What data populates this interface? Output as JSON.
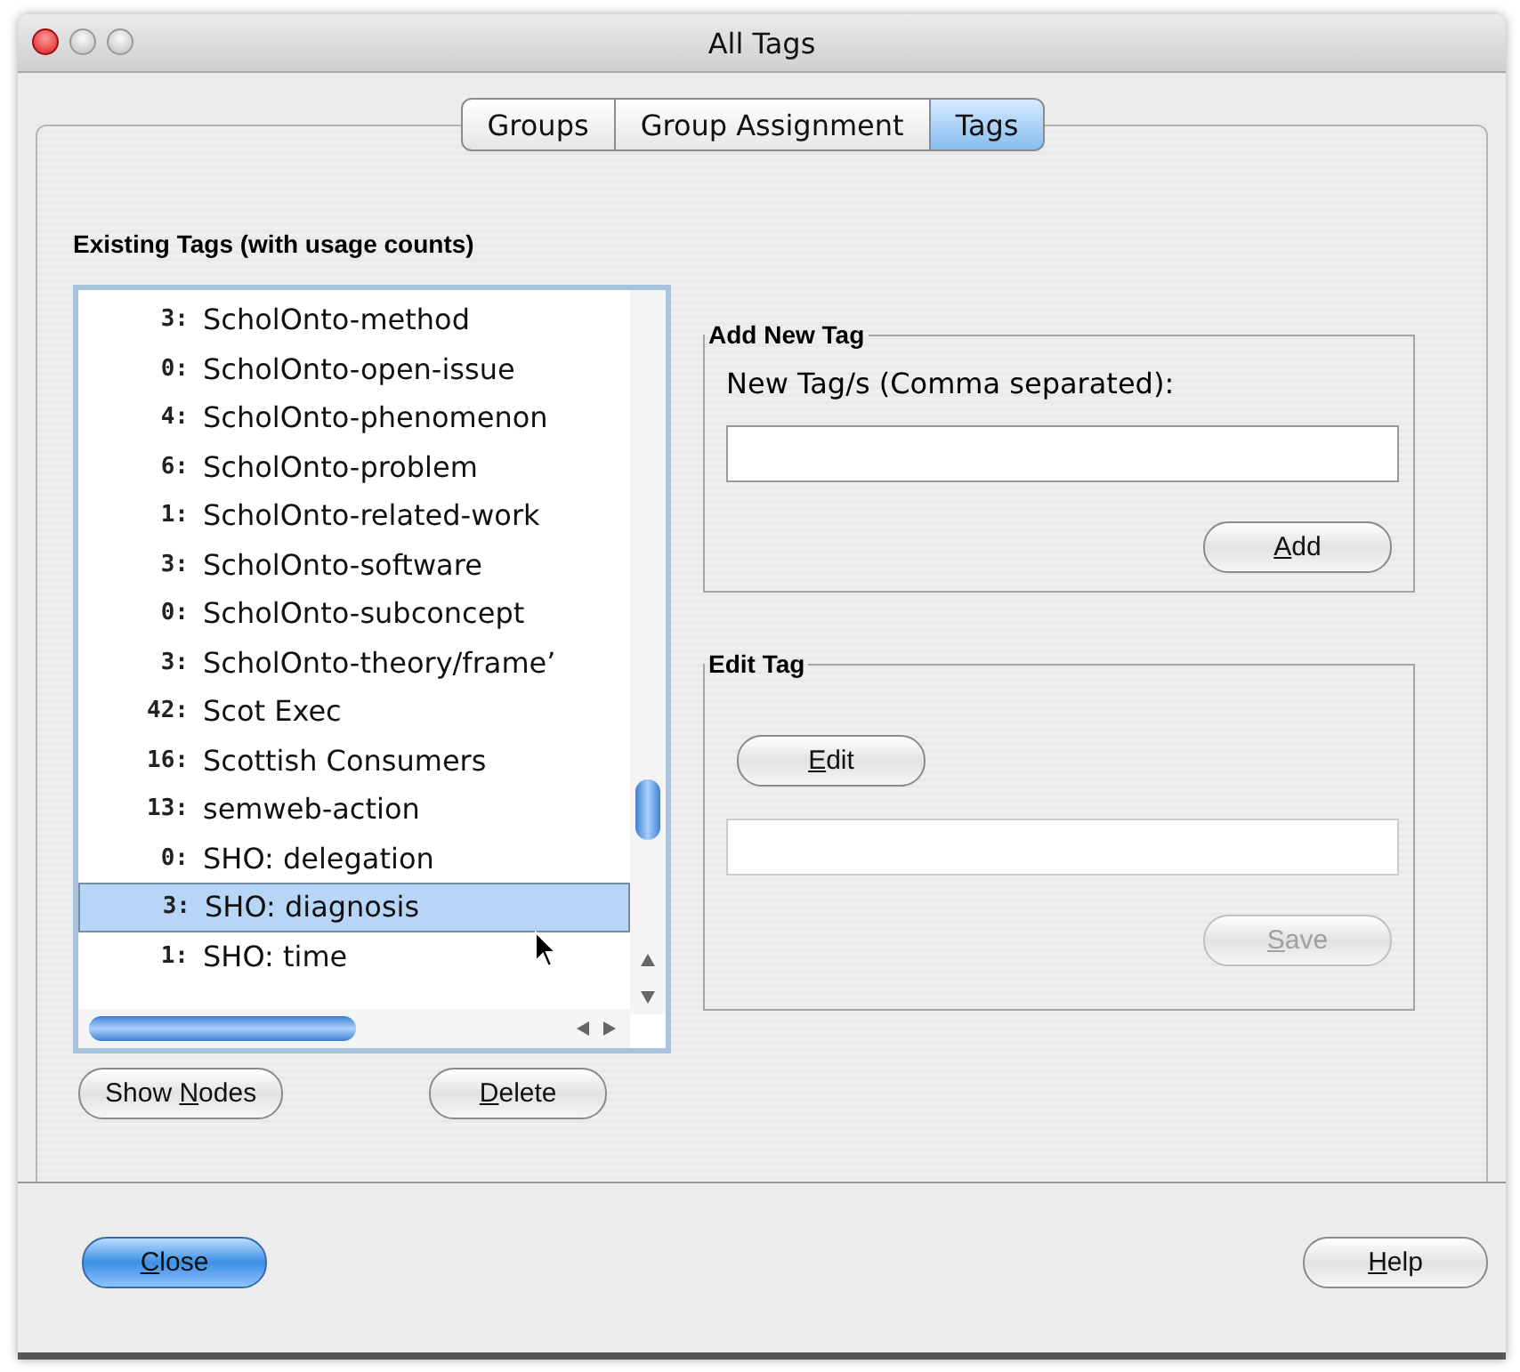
{
  "window": {
    "title": "All Tags"
  },
  "tabs": [
    {
      "label": "Groups",
      "selected": false
    },
    {
      "label": "Group Assignment",
      "selected": false
    },
    {
      "label": "Tags",
      "selected": true
    }
  ],
  "tag_list": {
    "heading": "Existing Tags (with usage counts)",
    "rows": [
      {
        "count": "3:",
        "name": "ScholOnto-method",
        "selected": false
      },
      {
        "count": "0:",
        "name": "ScholOnto-open-issue",
        "selected": false
      },
      {
        "count": "4:",
        "name": "ScholOnto-phenomenon",
        "selected": false
      },
      {
        "count": "6:",
        "name": "ScholOnto-problem",
        "selected": false
      },
      {
        "count": "1:",
        "name": "ScholOnto-related-work",
        "selected": false
      },
      {
        "count": "3:",
        "name": "ScholOnto-software",
        "selected": false
      },
      {
        "count": "0:",
        "name": "ScholOnto-subconcept",
        "selected": false
      },
      {
        "count": "3:",
        "name": "ScholOnto-theory/frame’",
        "selected": false
      },
      {
        "count": "42:",
        "name": "Scot Exec",
        "selected": false
      },
      {
        "count": "16:",
        "name": "Scottish Consumers",
        "selected": false
      },
      {
        "count": "13:",
        "name": "semweb-action",
        "selected": false
      },
      {
        "count": "0:",
        "name": "SHO: delegation",
        "selected": false
      },
      {
        "count": "3:",
        "name": "SHO: diagnosis",
        "selected": true
      },
      {
        "count": "1:",
        "name": "SHO: time",
        "selected": false
      }
    ],
    "buttons": [
      {
        "before": "Show ",
        "key": "N",
        "after": "odes",
        "disabled": false,
        "default": false
      },
      {
        "key": "D",
        "after": "elete",
        "disabled": false,
        "default": false
      }
    ]
  },
  "add_new_tag": {
    "title": "Add New Tag",
    "label": "New Tag/s (Comma separated):",
    "button": {
      "key": "A",
      "after": "dd",
      "disabled": false,
      "default": false
    }
  },
  "edit_tag": {
    "title": "Edit Tag",
    "edit_button": {
      "key": "E",
      "after": "dit",
      "disabled": false,
      "default": false
    },
    "save_button": {
      "key": "S",
      "after": "ave",
      "disabled": true,
      "default": false
    }
  },
  "footer_buttons": [
    {
      "key": "C",
      "after": "lose",
      "disabled": false,
      "default": true
    },
    {
      "key": "H",
      "after": "elp",
      "disabled": false,
      "default": false
    }
  ]
}
